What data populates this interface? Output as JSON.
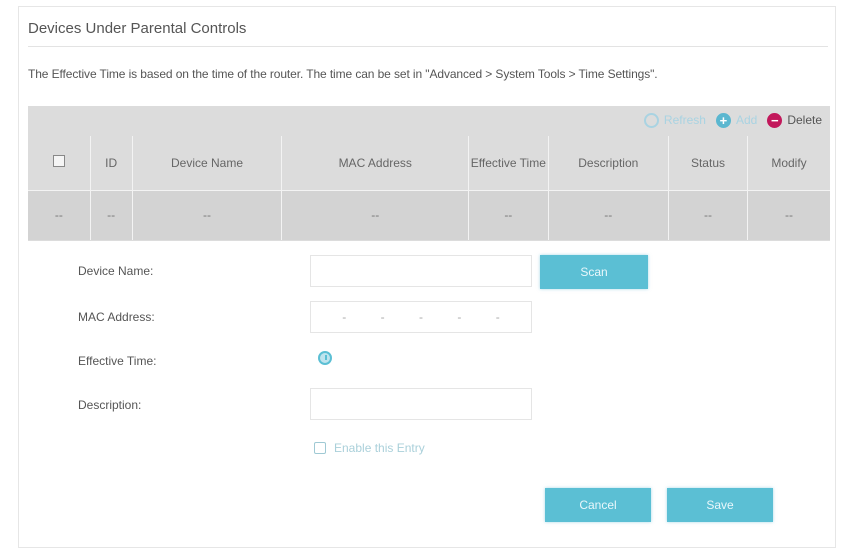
{
  "page": {
    "title": "Devices Under Parental Controls",
    "note": "The Effective Time is based on the time of the router. The time can be set in \"Advanced > System Tools > Time Settings\"."
  },
  "toolbar": {
    "refresh_label": "Refresh",
    "add_label": "Add",
    "delete_label": "Delete"
  },
  "table": {
    "headers": [
      "",
      "ID",
      "Device Name",
      "MAC Address",
      "Effective Time",
      "Description",
      "Status",
      "Modify"
    ],
    "empty_row": [
      "--",
      "--",
      "--",
      "--",
      "--",
      "--",
      "--",
      "--"
    ]
  },
  "form": {
    "device_name_label": "Device Name:",
    "device_name_value": "",
    "scan_label": "Scan",
    "mac_label": "MAC Address:",
    "mac_separator": "-",
    "effective_time_label": "Effective Time:",
    "description_label": "Description:",
    "description_value": "",
    "enable_label": "Enable this Entry",
    "enable_checked": false,
    "cancel_label": "Cancel",
    "save_label": "Save"
  },
  "colors": {
    "accent": "#5bbfd4",
    "delete": "#c2185b",
    "table_bg": "#dcdcdc"
  },
  "icons": [
    "refresh-icon",
    "add-icon",
    "delete-icon",
    "clock-icon",
    "checkbox-icon"
  ]
}
